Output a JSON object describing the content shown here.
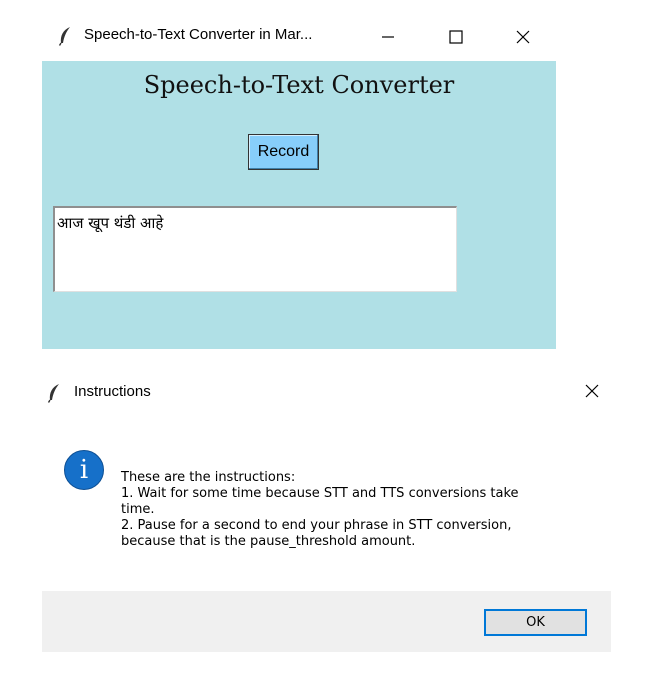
{
  "main_window": {
    "title": "Speech-to-Text Converter in Mar...",
    "heading": "Speech-to-Text Converter",
    "record_label": "Record",
    "text_output": "आज खूप थंडी आहे",
    "colors": {
      "background": "#b0e0e6",
      "record_button": "#87cefa"
    },
    "icons": [
      "feather-icon",
      "minimize-icon",
      "maximize-icon",
      "close-icon"
    ]
  },
  "dialog": {
    "title": "Instructions",
    "message_lines": [
      "These are the instructions:",
      "1. Wait for some time because STT and TTS conversions take",
      "time.",
      "2. Pause for a second to end your phrase in STT conversion,",
      "because that is the pause_threshold amount."
    ],
    "ok_label": "OK",
    "info_glyph": "i",
    "colors": {
      "info_icon": "#1670c9",
      "ok_border": "#0078d7"
    },
    "icons": [
      "feather-icon",
      "info-icon",
      "close-icon"
    ]
  }
}
